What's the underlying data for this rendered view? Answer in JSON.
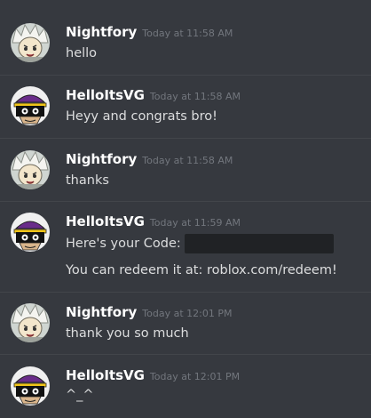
{
  "messages": [
    {
      "author": "Nightfory",
      "timestamp": "Today at 11:58 AM",
      "avatar": "nightfory-avatar",
      "lines": [
        "hello"
      ]
    },
    {
      "author": "HelloItsVG",
      "timestamp": "Today at 11:58 AM",
      "avatar": "helloitsvg-avatar",
      "lines": [
        "Heyy and congrats bro!"
      ]
    },
    {
      "author": "Nightfory",
      "timestamp": "Today at 11:58 AM",
      "avatar": "nightfory-avatar",
      "lines": [
        "thanks"
      ]
    },
    {
      "author": "HelloItsVG",
      "timestamp": "Today at 11:59 AM",
      "avatar": "helloitsvg-avatar",
      "lines": [
        "Here's your Code:",
        "You can redeem it at: roblox.com/redeem!"
      ]
    },
    {
      "author": "Nightfory",
      "timestamp": "Today at 12:01 PM",
      "avatar": "nightfory-avatar",
      "lines": [
        "thank you so much"
      ]
    },
    {
      "author": "HelloItsVG",
      "timestamp": "Today at 12:01 PM",
      "avatar": "helloitsvg-avatar",
      "lines": [
        "^_^"
      ]
    }
  ],
  "colors": {
    "background": "#36393f",
    "username": "#ffffff",
    "timestamp": "#72767d",
    "text": "#dcddde",
    "divider": "#42454a",
    "redacted": "#202225"
  }
}
